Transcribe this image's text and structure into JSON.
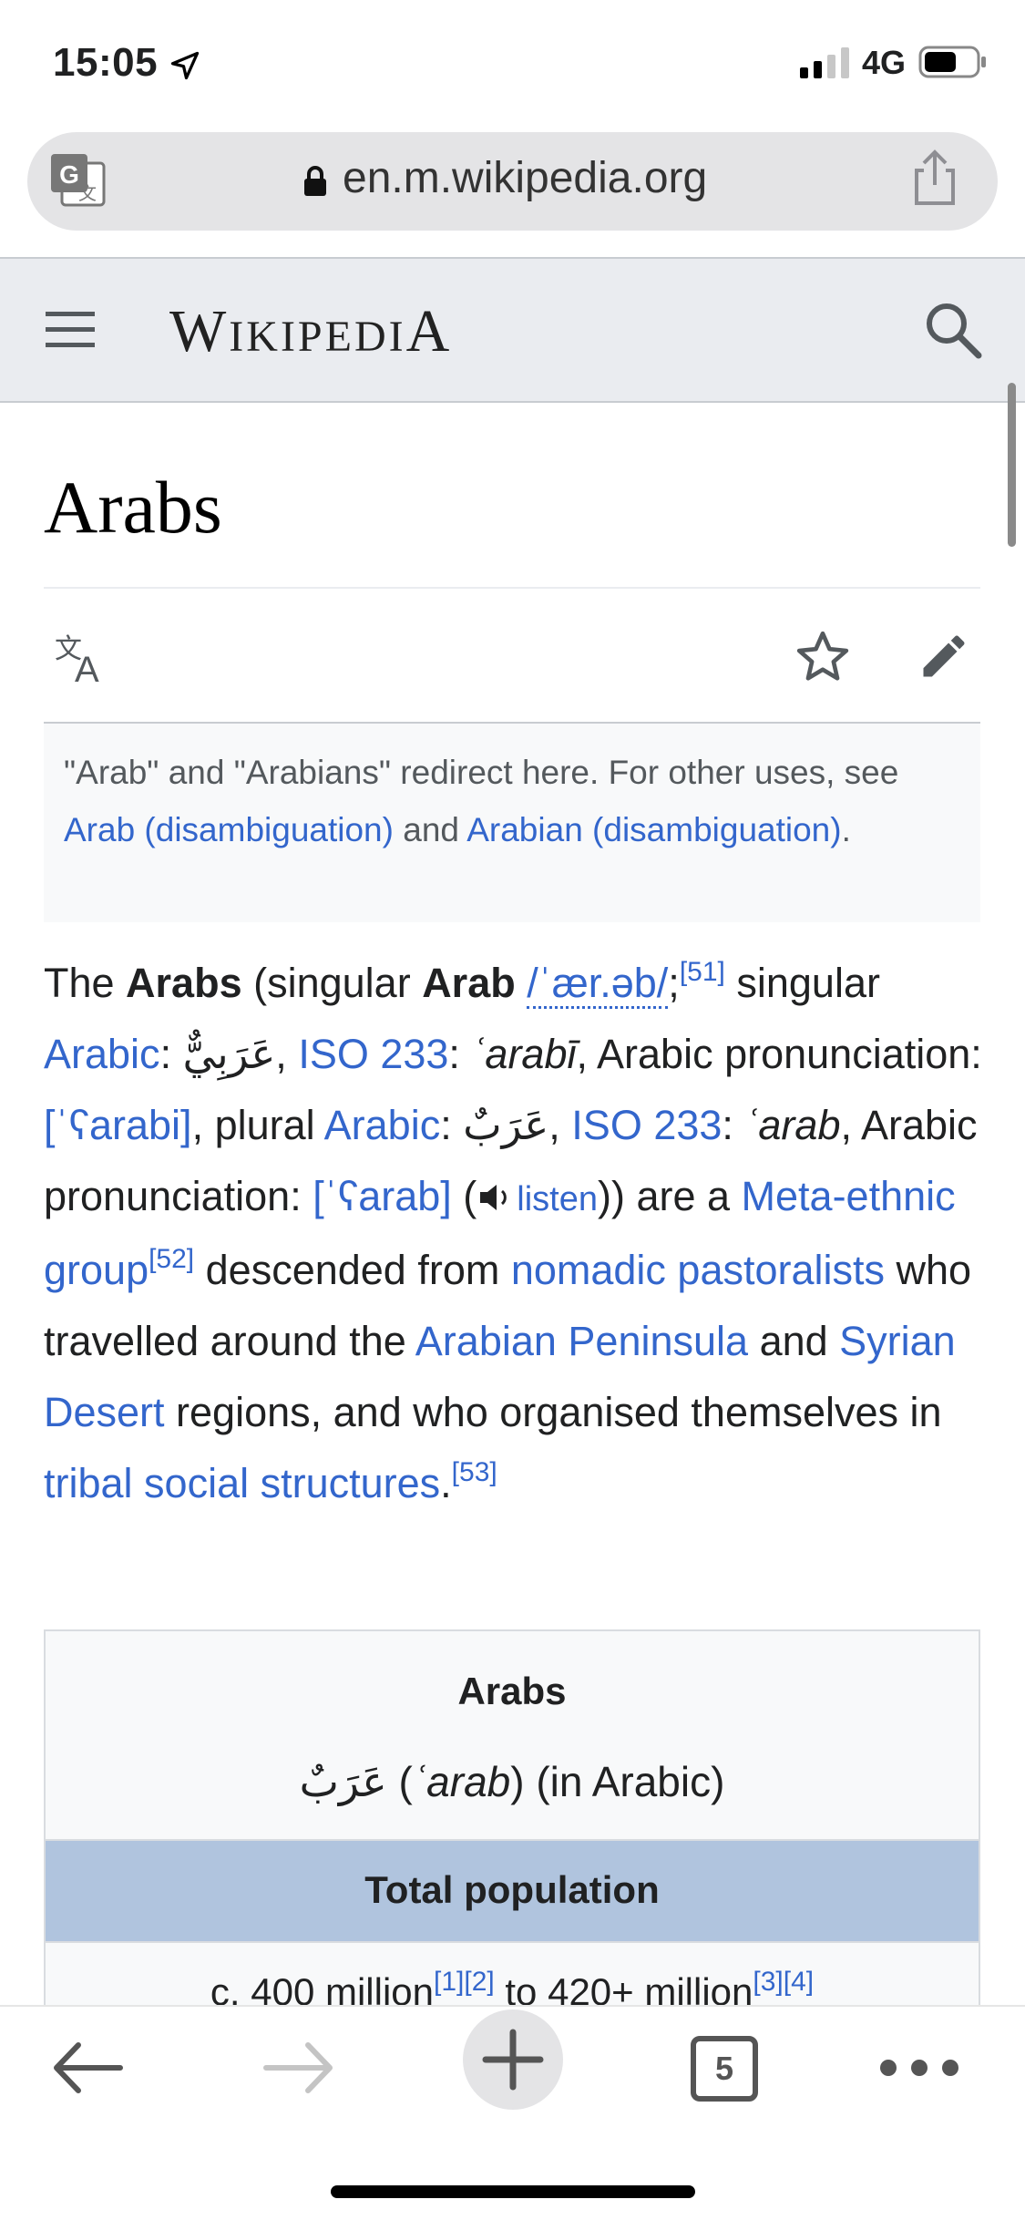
{
  "status_bar": {
    "time": "15:05",
    "network": "4G"
  },
  "browser": {
    "url": "en.m.wikipedia.org",
    "open_tabs": "5"
  },
  "wiki_header": {
    "wordmark_first": "W",
    "wordmark_rest": "IKIPEDI",
    "wordmark_last": "A"
  },
  "article": {
    "title": "Arabs",
    "hatnote": {
      "text_1": "\"Arab\" and \"Arabians\" redirect here. For other uses, see ",
      "link_1": "Arab (disambiguation)",
      "text_2": " and ",
      "link_2": "Arabian (disambiguation)",
      "text_3": "."
    },
    "paragraph": {
      "t1": "The ",
      "b1": "Arabs",
      "t2": " (singular ",
      "b2": "Arab",
      "t3": " ",
      "ipa1": "/ˈær.əb/",
      "t4": ";",
      "ref51": "[51]",
      "t5": " singular ",
      "link_arabic1": "Arabic",
      "t6": ": ",
      "arabic_singular": "عَرَبِيٌّ",
      "t7": ", ",
      "link_iso1": "ISO 233",
      "t8": ": ",
      "i_arabi": "ʿarabī",
      "t9": ", Arabic pronunciation: ",
      "ipa2": "[ˈʕarabi]",
      "t10": ", plural ",
      "link_arabic2": "Arabic",
      "t11": ": ",
      "arabic_plural": "عَرَبٌ",
      "t12": ", ",
      "link_iso2": "ISO 233",
      "t13": ": ",
      "i_arab": "ʿarab",
      "t14": ", Arabic pronunciation: ",
      "ipa3": "[ˈʕarab]",
      "t15": " (",
      "listen": "listen",
      "t16": ")) are a ",
      "link_meta": "Meta-ethnic group",
      "ref52": "[52]",
      "t17": " descended from ",
      "link_nomadic": "nomadic pastoralists",
      "t18": " who travelled around the ",
      "link_peninsula": "Arabian Peninsula",
      "t19": " and ",
      "link_syrian": "Syrian Desert",
      "t20": " regions, and who organised themselves in ",
      "link_tribal": "tribal social structures",
      "t21": ".",
      "ref53": "[53]"
    },
    "infobox": {
      "title": "Arabs",
      "native_arabic": "عَرَبٌ",
      "native_t1": " (",
      "native_translit": "ʿarab",
      "native_t2": ") (in Arabic)",
      "band_label": "Total population",
      "pop_t1": "c. 400 million",
      "pop_ref1": "[1]",
      "pop_ref2": "[2]",
      "pop_t2": " to 420+ million",
      "pop_ref3": "[3]",
      "pop_ref4": "[4]"
    }
  },
  "icons": [
    "location-arrow-icon",
    "signal-icon",
    "battery-icon",
    "google-translate-icon",
    "lock-icon",
    "share-icon",
    "hamburger-menu-icon",
    "search-icon",
    "language-icon",
    "star-icon",
    "pencil-edit-icon",
    "speaker-icon",
    "back-arrow-icon",
    "forward-arrow-icon",
    "plus-icon",
    "more-dots-icon"
  ],
  "colors": {
    "link": "#3366cc",
    "header_bg": "#eaecf0",
    "infobox_band": "#b0c4de",
    "url_bar": "#e4e4e6"
  }
}
